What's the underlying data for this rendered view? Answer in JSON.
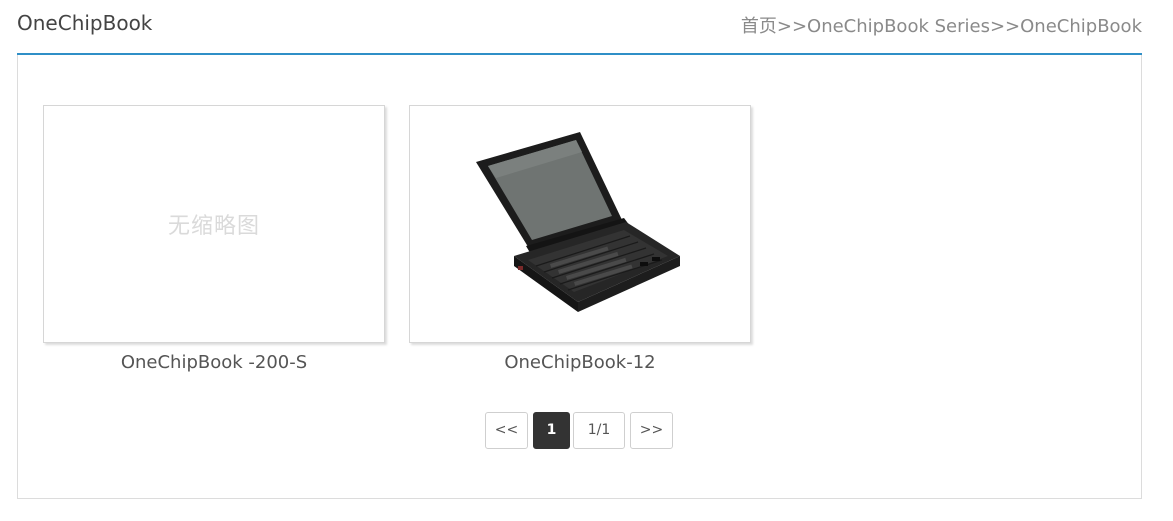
{
  "header": {
    "title": "OneChipBook",
    "breadcrumb": [
      "首页",
      ">>",
      "OneChipBook Series",
      ">>",
      "OneChipBook"
    ]
  },
  "products": [
    {
      "name": "OneChipBook -200-S",
      "thumbnail_text": "无缩略图"
    },
    {
      "name": "OneChipBook-12"
    }
  ],
  "pagination": {
    "prev_label": "<<",
    "current_page": "1",
    "page_info": "1/1",
    "next_label": ">>"
  },
  "colors": {
    "accent": "#2f8fc7",
    "current_page_bg": "#333333"
  }
}
